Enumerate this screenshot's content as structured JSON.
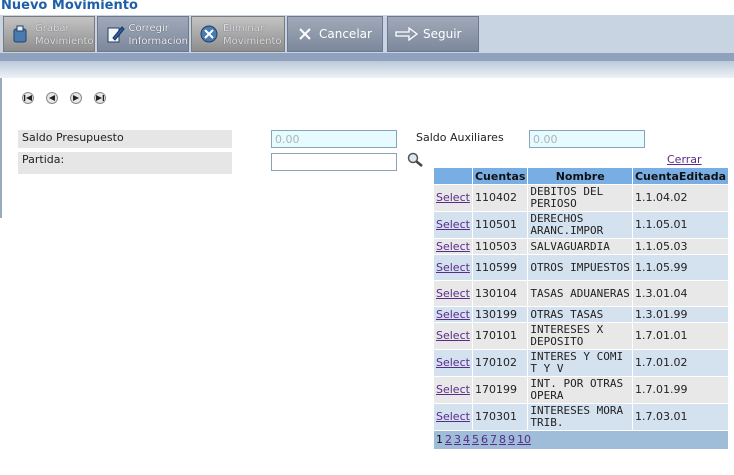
{
  "title": "Nuevo Movimiento",
  "toolbar": {
    "grabar": {
      "line1": "Grabar",
      "line2": "Movimiento"
    },
    "corregir": {
      "line1": "Corregir",
      "line2": "Informacion"
    },
    "eliminar": {
      "line1": "Eliminar",
      "line2": "Movimiento"
    },
    "cancelar": "Cancelar",
    "seguir": "Seguir"
  },
  "form": {
    "saldo_presupuesto_label": "Saldo Presupuesto",
    "saldo_presupuesto_value": "0.00",
    "saldo_auxiliares_label": "Saldo Auxiliares",
    "saldo_auxiliares_value": "0.00",
    "partida_label": "Partida:",
    "partida_value": ""
  },
  "popup": {
    "cerrar": "Cerrar",
    "columns": [
      "",
      "Cuentas",
      "Nombre",
      "CuentaEditada"
    ],
    "select_label": "Select",
    "rows": [
      {
        "cuenta": "110402",
        "nombre": "DEBITOS DEL PERIOSO",
        "editada": "1.1.04.02"
      },
      {
        "cuenta": "110501",
        "nombre": "DERECHOS ARANC.IMPOR",
        "editada": "1.1.05.01"
      },
      {
        "cuenta": "110503",
        "nombre": "SALVAGUARDIA",
        "editada": "1.1.05.03"
      },
      {
        "cuenta": "110599",
        "nombre": "OTROS IMPUESTOS",
        "editada": "1.1.05.99"
      },
      {
        "cuenta": "130104",
        "nombre": "TASAS ADUANERAS",
        "editada": "1.3.01.04"
      },
      {
        "cuenta": "130199",
        "nombre": "OTRAS TASAS",
        "editada": "1.3.01.99"
      },
      {
        "cuenta": "170101",
        "nombre": "INTERESES X DEPOSITO",
        "editada": "1.7.01.01"
      },
      {
        "cuenta": "170102",
        "nombre": "INTERES Y COMI T Y V",
        "editada": "1.7.01.02"
      },
      {
        "cuenta": "170199",
        "nombre": "INT. POR OTRAS OPERA",
        "editada": "1.7.01.99"
      },
      {
        "cuenta": "170301",
        "nombre": "INTERESES MORA TRIB.",
        "editada": "1.7.03.01"
      }
    ],
    "pager": {
      "current": "1",
      "pages": [
        "2",
        "3",
        "4",
        "5",
        "6",
        "7",
        "8",
        "9",
        "10"
      ]
    }
  },
  "icons": {
    "grabar": "save-icon",
    "corregir": "edit-icon",
    "eliminar": "delete-icon",
    "cancelar": "x-icon",
    "seguir": "arrow-right-icon",
    "buscar": "magnifier-icon",
    "nav": [
      "first-icon",
      "prev-icon",
      "next-icon",
      "last-icon"
    ]
  }
}
